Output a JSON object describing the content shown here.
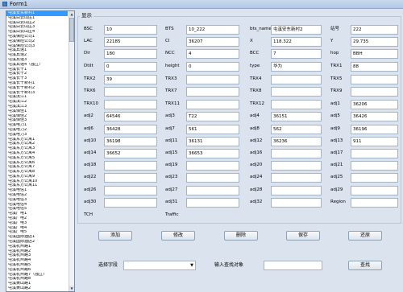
{
  "window": {
    "title": "Form1"
  },
  "list": {
    "selected_index": 0,
    "items": [
      "屯溪安东新村1",
      "屯溪白云山庄1",
      "屯溪白云山庄2",
      "屯溪白云山庄3",
      "屯溪白云山庄4",
      "屯溪保险公司1",
      "屯溪保险公司2",
      "屯溪保险公司3",
      "屯溪宾馆1",
      "屯溪宾馆2",
      "屯溪宾馆3",
      "屯溪宾馆4（独立）",
      "屯溪长干1",
      "屯溪长干2",
      "屯溪长干3",
      "屯溪长干新村1",
      "屯溪长干新村2",
      "屯溪长干新村3",
      "屯溪滨江1",
      "屯溪滨江2",
      "屯溪滨江3",
      "屯溪佰佳1",
      "屯溪佰佳2",
      "屯溪佰佳3",
      "屯溪电力1",
      "屯溪电力2",
      "屯溪电力3",
      "屯溪东方公寓1",
      "屯溪东方公寓2",
      "屯溪东方公寓3",
      "屯溪东方公寓4",
      "屯溪东方公寓5",
      "屯溪东方公寓6",
      "屯溪东方公寓7",
      "屯溪东方公寓8",
      "屯溪东方公寓9",
      "屯溪东方公寓10",
      "屯溪东方公寓11",
      "屯溪电信1",
      "屯溪电信2",
      "屯溪电信3",
      "屯溪电信4",
      "屯溪电信5",
      "屯溪广电1",
      "屯溪广电2",
      "屯溪广电3",
      "屯溪广电4",
      "屯溪广电5",
      "屯溪国际酒店1",
      "屯溪国际酒店2",
      "屯溪杭州路1",
      "屯溪杭州路2",
      "屯溪杭州路3",
      "屯溪杭州路4",
      "屯溪杭州路5",
      "屯溪杭州路6",
      "屯溪杭州路7（独立）",
      "屯溪杭州路8",
      "屯溪黄山路1",
      "屯溪黄山路2",
      "屯溪黄山路3"
    ]
  },
  "panel": {
    "title": "显示"
  },
  "fields": [
    {
      "label": "BSC",
      "value": "10"
    },
    {
      "label": "BTS",
      "value": "10_222"
    },
    {
      "label": "bts_name",
      "value": "屯溪安东新村2"
    },
    {
      "label": "站号",
      "value": "222"
    },
    {
      "label": "LAC",
      "value": "22185"
    },
    {
      "label": "CI",
      "value": "36207"
    },
    {
      "label": "X",
      "value": "118.322"
    },
    {
      "label": "Y",
      "value": "29.735"
    },
    {
      "label": "Dir",
      "value": "180"
    },
    {
      "label": "NCC",
      "value": "4"
    },
    {
      "label": "BCC",
      "value": "7"
    },
    {
      "label": "hop",
      "value": "BBH"
    },
    {
      "label": "Dtilt",
      "value": "0"
    },
    {
      "label": "height",
      "value": "0"
    },
    {
      "label": "type",
      "value": "华为"
    },
    {
      "label": "TRX1",
      "value": "88"
    },
    {
      "label": "TRX2",
      "value": "39"
    },
    {
      "label": "TRX3",
      "value": ""
    },
    {
      "label": "TRX4",
      "value": ""
    },
    {
      "label": "TRX5",
      "value": ""
    },
    {
      "label": "TRX6",
      "value": ""
    },
    {
      "label": "TRX7",
      "value": ""
    },
    {
      "label": "TRX8",
      "value": ""
    },
    {
      "label": "TRX9",
      "value": ""
    },
    {
      "label": "TRX10",
      "value": ""
    },
    {
      "label": "TRX11",
      "value": ""
    },
    {
      "label": "TRX12",
      "value": ""
    },
    {
      "label": "adj1",
      "value": "36206"
    },
    {
      "label": "adj2",
      "value": "64546"
    },
    {
      "label": "adj3",
      "value": "T22"
    },
    {
      "label": "adj4",
      "value": "36151"
    },
    {
      "label": "adj5",
      "value": "36426"
    },
    {
      "label": "adj6",
      "value": "36428"
    },
    {
      "label": "adj7",
      "value": "561"
    },
    {
      "label": "adj8",
      "value": "562"
    },
    {
      "label": "adj9",
      "value": "36196"
    },
    {
      "label": "adj10",
      "value": "36198"
    },
    {
      "label": "adj11",
      "value": "36131"
    },
    {
      "label": "adj12",
      "value": "36236"
    },
    {
      "label": "adj13",
      "value": "911"
    },
    {
      "label": "adj14",
      "value": "36652"
    },
    {
      "label": "adj15",
      "value": "36653"
    },
    {
      "label": "adj16",
      "value": ""
    },
    {
      "label": "adj17",
      "value": ""
    },
    {
      "label": "adj18",
      "value": ""
    },
    {
      "label": "adj19",
      "value": ""
    },
    {
      "label": "adj20",
      "value": ""
    },
    {
      "label": "adj21",
      "value": ""
    },
    {
      "label": "adj22",
      "value": ""
    },
    {
      "label": "adj23",
      "value": ""
    },
    {
      "label": "adj24",
      "value": ""
    },
    {
      "label": "adj25",
      "value": ""
    },
    {
      "label": "adj26",
      "value": ""
    },
    {
      "label": "adj27",
      "value": ""
    },
    {
      "label": "adj28",
      "value": ""
    },
    {
      "label": "adj29",
      "value": ""
    },
    {
      "label": "adj30",
      "value": ""
    },
    {
      "label": "adj31",
      "value": ""
    },
    {
      "label": "adj32",
      "value": ""
    },
    {
      "label": "Region",
      "value": ""
    },
    {
      "label": "TCH",
      "value": ""
    },
    {
      "label": "Traffic",
      "value": ""
    }
  ],
  "buttons": {
    "add": "添加",
    "modify": "修改",
    "delete": "删除",
    "save": "保存",
    "restore": "还原",
    "search": "查找"
  },
  "search": {
    "field_label": "选择字段",
    "field_value": "",
    "query_label": "输入查找对象",
    "query_value": ""
  }
}
